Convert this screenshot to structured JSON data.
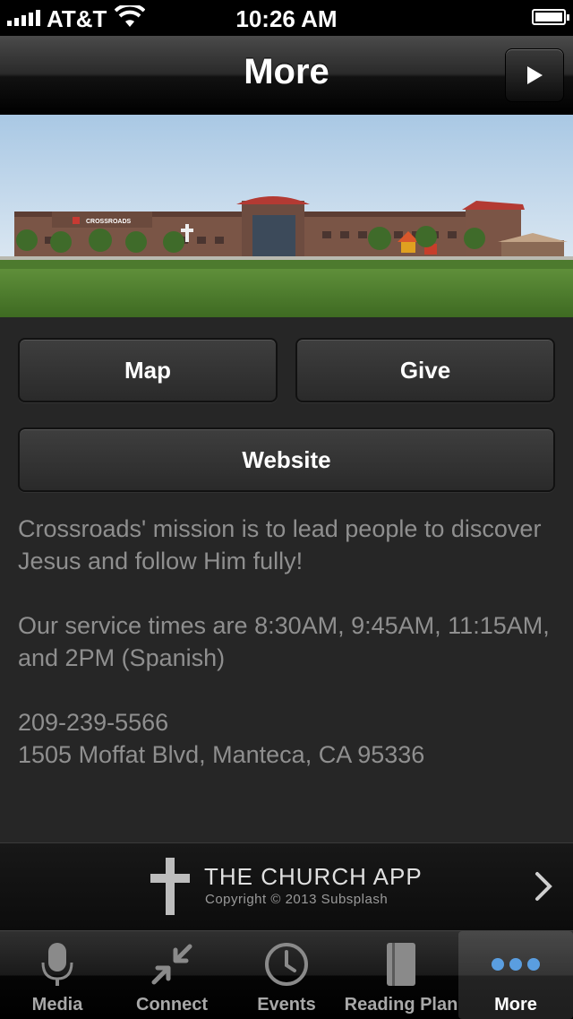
{
  "status_bar": {
    "carrier": "AT&T",
    "time": "10:26 AM"
  },
  "nav": {
    "title": "More",
    "play_icon": "play-icon"
  },
  "hero": {
    "sign_text": "CROSSROADS"
  },
  "buttons": {
    "map": "Map",
    "give": "Give",
    "website": "Website"
  },
  "info": {
    "mission": "Crossroads' mission is to lead people to discover Jesus and follow Him fully!",
    "service_times": "Our service times are 8:30AM, 9:45AM, 11:15AM, and 2PM (Spanish)",
    "phone": "209-239-5566",
    "address": "1505 Moffat Blvd, Manteca, CA 95336"
  },
  "footer": {
    "app_name": "THE CHURCH APP",
    "copyright": "Copyright © 2013 Subsplash"
  },
  "tabs": [
    {
      "label": "Media",
      "icon": "microphone-icon",
      "active": false
    },
    {
      "label": "Connect",
      "icon": "connect-arrows-icon",
      "active": false
    },
    {
      "label": "Events",
      "icon": "clock-icon",
      "active": false
    },
    {
      "label": "Reading Plan",
      "icon": "book-icon",
      "active": false
    },
    {
      "label": "More",
      "icon": "more-dots-icon",
      "active": true
    }
  ],
  "colors": {
    "background": "#262626",
    "text_muted": "#8f8f8f",
    "active_dots": "#5a9ee0"
  }
}
